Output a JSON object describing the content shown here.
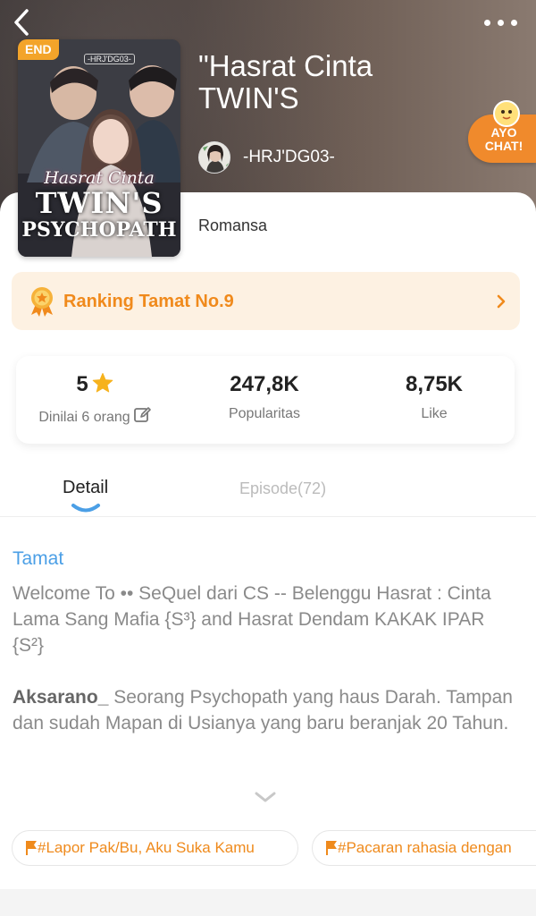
{
  "header": {
    "back_icon": "chevron-left-icon",
    "more_icon": "more-horizontal-icon"
  },
  "book": {
    "title": "\"Hasrat Cinta TWIN'S",
    "status_badge": "END",
    "cover_tag": "-HRJ'DG03-",
    "cover_title_line1": "Hasrat Cinta",
    "cover_title_line2": "TWIN'S",
    "cover_title_line3": "PSYCHOPATH",
    "author": "-HRJ'DG03-",
    "genre": "Romansa"
  },
  "ayo_chat": {
    "line1": "AYO",
    "line2": "CHAT!"
  },
  "ranking": {
    "label": "Ranking Tamat No.9",
    "icon": "medal-icon",
    "accent": "#f08a1c",
    "background": "#fdf1e2"
  },
  "stats": {
    "rating_value": "5",
    "rating_label": "Dinilai 6 orang",
    "popularity_value": "247,8K",
    "popularity_label": "Popularitas",
    "like_value": "8,75K",
    "like_label": "Like"
  },
  "tabs": {
    "detail": "Detail",
    "episode": "Episode(72)"
  },
  "detail": {
    "status": "Tamat",
    "paragraph1": "Welcome To •• SeQuel dari CS -- Belenggu Hasrat : Cinta Lama Sang Mafia {S³} and Hasrat Dendam KAKAK IPAR {S²}",
    "paragraph2_bold": "Aksarano_",
    "paragraph2_rest": " Seorang Psychopath yang haus Darah. Tampan dan sudah Mapan di Usianya yang baru beranjak 20 Tahun."
  },
  "tags": [
    {
      "label": "#Lapor Pak/Bu, Aku Suka Kamu"
    },
    {
      "label": "#Pacaran rahasia dengan"
    }
  ],
  "colors": {
    "tab_active_indicator": "#4b9fe6",
    "status_text": "#4b9fe6",
    "tag_text": "#ef8a1c",
    "ayo_chat_bg": "#f08a2c"
  }
}
